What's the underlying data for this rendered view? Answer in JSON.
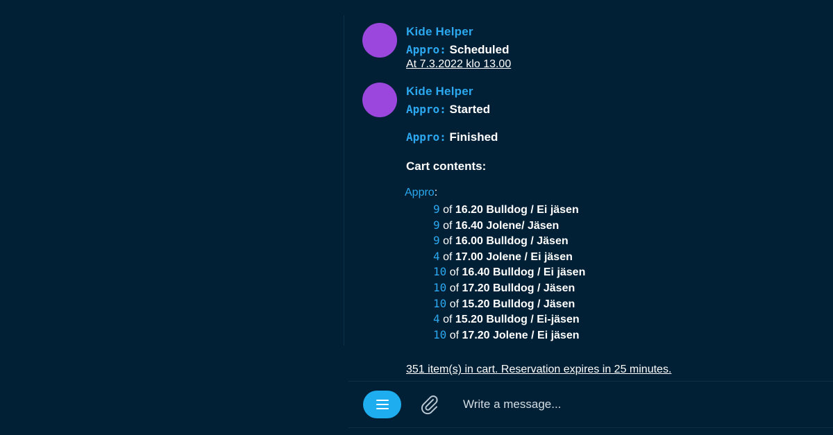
{
  "messages": [
    {
      "sender": "Kide Helper",
      "lines": [
        {
          "label": "Appro:",
          "text": "Scheduled"
        }
      ],
      "subtext": "At 7.3.2022 klo 13.00"
    },
    {
      "sender": "Kide Helper",
      "started": {
        "label": "Appro:",
        "text": "Started"
      },
      "finished": {
        "label": "Appro:",
        "text": "Finished"
      },
      "cart_heading": "Cart contents:",
      "project": "Appro",
      "project_colon": ":",
      "items": [
        {
          "qty": "9",
          "of": "of",
          "name": "16.20 Bulldog / Ei jäsen"
        },
        {
          "qty": "9",
          "of": "of",
          "name": "16.40 Jolene/ Jäsen"
        },
        {
          "qty": "9",
          "of": "of",
          "name": "16.00 Bulldog / Jäsen"
        },
        {
          "qty": "4",
          "of": "of",
          "name": "17.00 Jolene / Ei jäsen"
        },
        {
          "qty": "10",
          "of": "of",
          "name": "16.40 Bulldog / Ei jäsen"
        },
        {
          "qty": "10",
          "of": "of",
          "name": "17.20 Bulldog / Jäsen"
        },
        {
          "qty": "10",
          "of": "of",
          "name": "15.20 Bulldog / Jäsen"
        },
        {
          "qty": "4",
          "of": "of",
          "name": "15.20 Bulldog / Ei-jäsen"
        },
        {
          "qty": "10",
          "of": "of",
          "name": "17.20 Jolene / Ei jäsen"
        }
      ]
    }
  ],
  "summary": "351 item(s) in cart. Reservation expires in 25 minutes.",
  "composer": {
    "placeholder": "Write a message...",
    "menu_icon": "menu-icon",
    "attach_icon": "paperclip-icon"
  },
  "colors": {
    "background": "#022035",
    "accent": "#2ba8ef",
    "avatar": "#9b47dd",
    "button": "#1eaef0"
  }
}
